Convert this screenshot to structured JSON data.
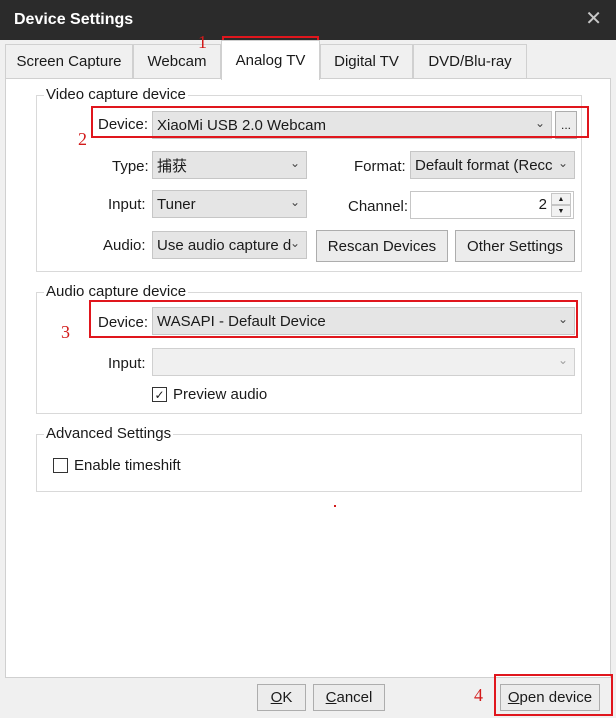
{
  "window": {
    "title": "Device Settings",
    "close": "✕"
  },
  "tabs": [
    {
      "label": "Screen Capture"
    },
    {
      "label": "Webcam"
    },
    {
      "label": "Analog TV"
    },
    {
      "label": "Digital TV"
    },
    {
      "label": "DVD/Blu-ray"
    }
  ],
  "video_group": {
    "legend": "Video capture device",
    "device_label": "Device:",
    "device_value": "XiaoMi USB 2.0 Webcam",
    "browse_label": "...",
    "type_label": "Type:",
    "type_value": "捕获",
    "format_label": "Format:",
    "format_value": "Default format (Recc",
    "input_label": "Input:",
    "input_value": "Tuner",
    "channel_label": "Channel:",
    "channel_value": "2",
    "audio_label": "Audio:",
    "audio_value": "Use audio capture d",
    "rescan_label": "Rescan Devices",
    "other_label": "Other Settings"
  },
  "audio_group": {
    "legend": "Audio capture device",
    "device_label": "Device:",
    "device_value": "WASAPI - Default Device",
    "input_label": "Input:",
    "input_value": "",
    "preview_label": "Preview audio",
    "preview_checked": true
  },
  "advanced_group": {
    "legend": "Advanced Settings",
    "timeshift_label": "Enable timeshift",
    "timeshift_checked": false
  },
  "footer": {
    "ok_accel": "O",
    "ok_rest": "K",
    "cancel_accel": "C",
    "cancel_rest": "ancel",
    "open_accel": "O",
    "open_rest": "pen device"
  },
  "annotations": {
    "n1": "1",
    "n2": "2",
    "n3": "3",
    "n4": "4",
    "color": "#e0161d"
  },
  "icons": {
    "chevron": "chevron-down-icon",
    "check": "checkmark-icon",
    "close": "close-icon"
  }
}
